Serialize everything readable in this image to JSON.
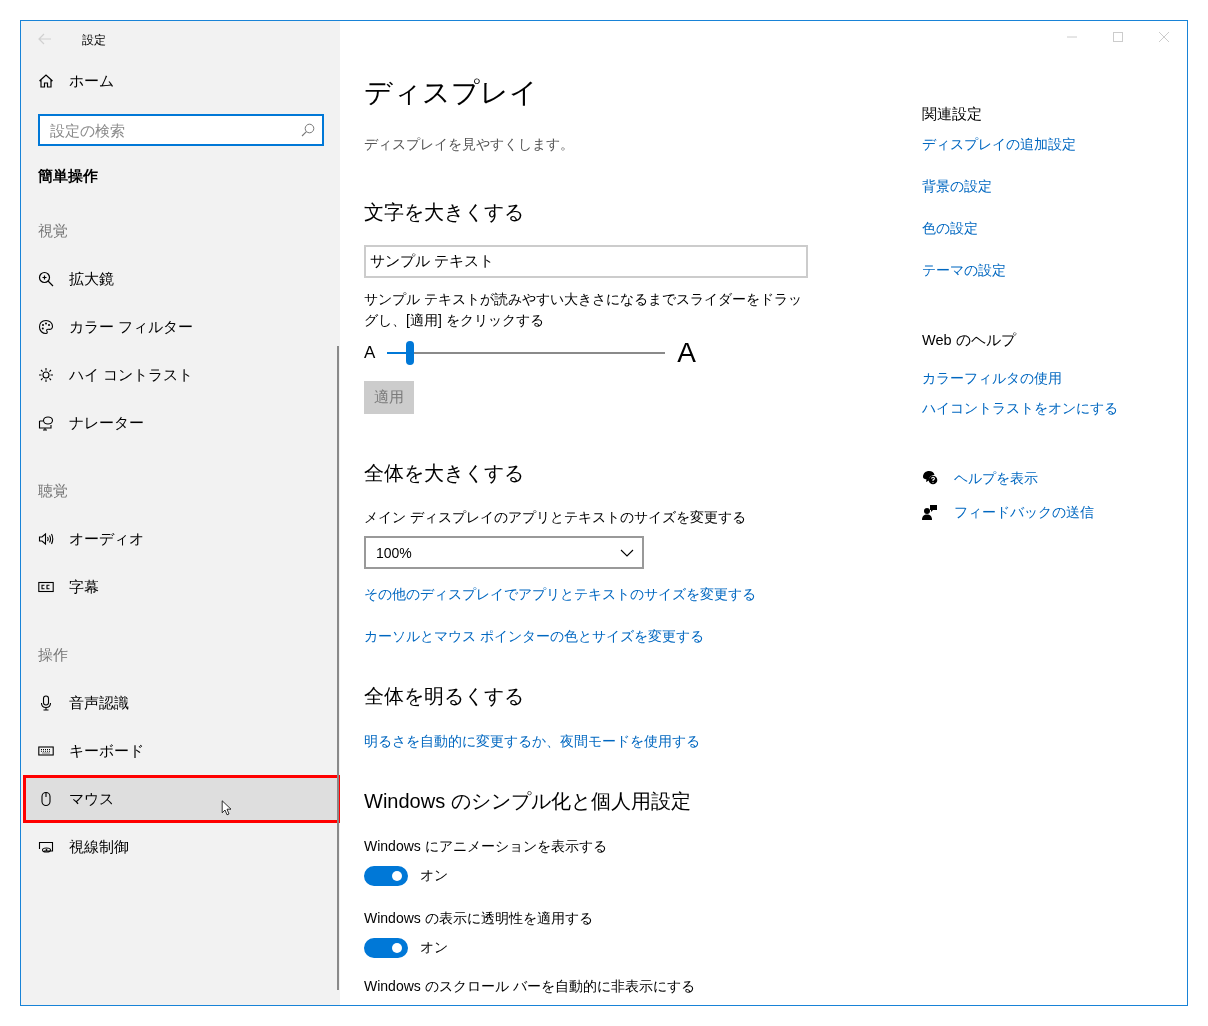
{
  "window": {
    "title": "設定"
  },
  "sidebar": {
    "home": "ホーム",
    "search": {
      "placeholder": "設定の検索"
    },
    "category": "簡単操作",
    "sections": [
      {
        "heading": "視覚",
        "items": [
          {
            "label": "拡大鏡",
            "selected": false
          },
          {
            "label": "カラー フィルター",
            "selected": false
          },
          {
            "label": "ハイ コントラスト",
            "selected": false
          },
          {
            "label": "ナレーター",
            "selected": false
          }
        ]
      },
      {
        "heading": "聴覚",
        "items": [
          {
            "label": "オーディオ",
            "selected": false
          },
          {
            "label": "字幕",
            "selected": false
          }
        ]
      },
      {
        "heading": "操作",
        "items": [
          {
            "label": "音声認識",
            "selected": false
          },
          {
            "label": "キーボード",
            "selected": false
          },
          {
            "label": "マウス",
            "selected": true
          },
          {
            "label": "視線制御",
            "selected": false
          }
        ]
      }
    ]
  },
  "main": {
    "title": "ディスプレイ",
    "subtitle": "ディスプレイを見やすくします。",
    "text_size": {
      "heading": "文字を大きくする",
      "sample_text": {
        "value": "サンプル テキスト"
      },
      "instructions": "サンプル テキストが読みやすい大きさになるまでスライダーをドラッグし、[適用] をクリックする",
      "slider": {
        "min_label": "A",
        "max_label": "A",
        "level": 0.08
      },
      "apply_button": {
        "label": "適用",
        "disabled": true
      }
    },
    "scale": {
      "heading": "全体を大きくする",
      "label": "メイン ディスプレイのアプリとテキストのサイズを変更する",
      "dropdown": {
        "value": "100%"
      },
      "links": [
        "その他のディスプレイでアプリとテキストのサイズを変更する",
        "カーソルとマウス ポインターの色とサイズを変更する"
      ]
    },
    "brightness": {
      "heading": "全体を明るくする",
      "links": [
        "明るさを自動的に変更するか、夜間モードを使用する"
      ]
    },
    "simplify": {
      "heading": "Windows のシンプル化と個人用設定",
      "settings": [
        {
          "label": "Windows にアニメーションを表示する",
          "on": true,
          "state_label": "オン"
        },
        {
          "label": "Windows の表示に透明性を適用する",
          "on": true,
          "state_label": "オン"
        }
      ],
      "next_label": "Windows のスクロール バーを自動的に非表示にする"
    }
  },
  "aside": {
    "related": {
      "heading": "関連設定",
      "links": [
        "ディスプレイの追加設定",
        "背景の設定",
        "色の設定",
        "テーマの設定"
      ]
    },
    "web_help": {
      "heading": "Web のヘルプ",
      "links": [
        "カラーフィルタの使用",
        "ハイコントラストをオンにする"
      ]
    },
    "support": [
      "ヘルプを表示",
      "フィードバックの送信"
    ]
  }
}
